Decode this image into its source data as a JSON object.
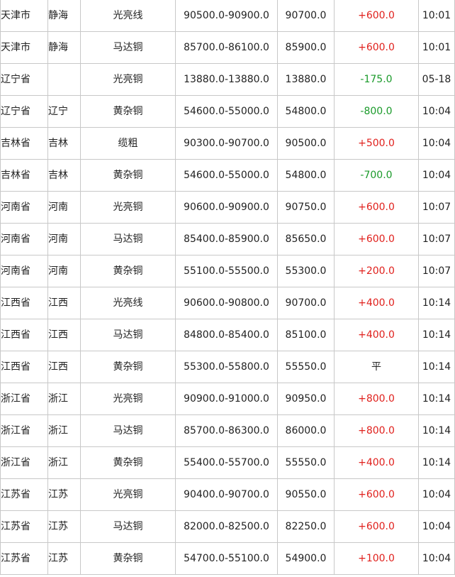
{
  "colors": {
    "up": "#e0201c",
    "down": "#1a9a2a",
    "flat": "#222222"
  },
  "rows": [
    {
      "province": "天津市",
      "city": "静海",
      "product": "光亮线",
      "range": "90500.0-90900.0",
      "avg": "90700.0",
      "change": "+600.0",
      "trend": "up",
      "time": "10:01"
    },
    {
      "province": "天津市",
      "city": "静海",
      "product": "马达铜",
      "range": "85700.0-86100.0",
      "avg": "85900.0",
      "change": "+600.0",
      "trend": "up",
      "time": "10:01"
    },
    {
      "province": "辽宁省",
      "city": "",
      "product": "光亮铜",
      "range": "13880.0-13880.0",
      "avg": "13880.0",
      "change": "-175.0",
      "trend": "down",
      "time": "05-18"
    },
    {
      "province": "辽宁省",
      "city": "辽宁",
      "product": "黄杂铜",
      "range": "54600.0-55000.0",
      "avg": "54800.0",
      "change": "-800.0",
      "trend": "down",
      "time": "10:04"
    },
    {
      "province": "吉林省",
      "city": "吉林",
      "product": "缆粗",
      "range": "90300.0-90700.0",
      "avg": "90500.0",
      "change": "+500.0",
      "trend": "up",
      "time": "10:04"
    },
    {
      "province": "吉林省",
      "city": "吉林",
      "product": "黄杂铜",
      "range": "54600.0-55000.0",
      "avg": "54800.0",
      "change": "-700.0",
      "trend": "down",
      "time": "10:04"
    },
    {
      "province": "河南省",
      "city": "河南",
      "product": "光亮铜",
      "range": "90600.0-90900.0",
      "avg": "90750.0",
      "change": "+600.0",
      "trend": "up",
      "time": "10:07"
    },
    {
      "province": "河南省",
      "city": "河南",
      "product": "马达铜",
      "range": "85400.0-85900.0",
      "avg": "85650.0",
      "change": "+600.0",
      "trend": "up",
      "time": "10:07"
    },
    {
      "province": "河南省",
      "city": "河南",
      "product": "黄杂铜",
      "range": "55100.0-55500.0",
      "avg": "55300.0",
      "change": "+200.0",
      "trend": "up",
      "time": "10:07"
    },
    {
      "province": "江西省",
      "city": "江西",
      "product": "光亮线",
      "range": "90600.0-90800.0",
      "avg": "90700.0",
      "change": "+400.0",
      "trend": "up",
      "time": "10:14"
    },
    {
      "province": "江西省",
      "city": "江西",
      "product": "马达铜",
      "range": "84800.0-85400.0",
      "avg": "85100.0",
      "change": "+400.0",
      "trend": "up",
      "time": "10:14"
    },
    {
      "province": "江西省",
      "city": "江西",
      "product": "黄杂铜",
      "range": "55300.0-55800.0",
      "avg": "55550.0",
      "change": "平",
      "trend": "flat",
      "time": "10:14"
    },
    {
      "province": "浙江省",
      "city": "浙江",
      "product": "光亮铜",
      "range": "90900.0-91000.0",
      "avg": "90950.0",
      "change": "+800.0",
      "trend": "up",
      "time": "10:14"
    },
    {
      "province": "浙江省",
      "city": "浙江",
      "product": "马达铜",
      "range": "85700.0-86300.0",
      "avg": "86000.0",
      "change": "+800.0",
      "trend": "up",
      "time": "10:14"
    },
    {
      "province": "浙江省",
      "city": "浙江",
      "product": "黄杂铜",
      "range": "55400.0-55700.0",
      "avg": "55550.0",
      "change": "+400.0",
      "trend": "up",
      "time": "10:14"
    },
    {
      "province": "江苏省",
      "city": "江苏",
      "product": "光亮铜",
      "range": "90400.0-90700.0",
      "avg": "90550.0",
      "change": "+600.0",
      "trend": "up",
      "time": "10:04"
    },
    {
      "province": "江苏省",
      "city": "江苏",
      "product": "马达铜",
      "range": "82000.0-82500.0",
      "avg": "82250.0",
      "change": "+600.0",
      "trend": "up",
      "time": "10:04"
    },
    {
      "province": "江苏省",
      "city": "江苏",
      "product": "黄杂铜",
      "range": "54700.0-55100.0",
      "avg": "54900.0",
      "change": "+100.0",
      "trend": "up",
      "time": "10:04"
    }
  ]
}
